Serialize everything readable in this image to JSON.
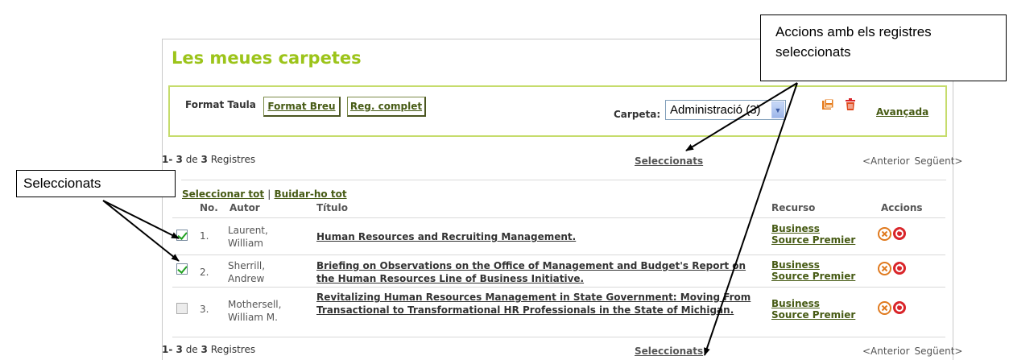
{
  "header": {
    "title": "Les meues carpetes"
  },
  "format": {
    "label": "Format Taula",
    "brief_label": "Format Breu",
    "complete_label": "Reg. complet"
  },
  "folder": {
    "label": "Carpeta:",
    "selected": "Administració (3)",
    "save_icon": "save-icon",
    "delete_icon": "trash-icon",
    "advanced_label": "Avançada"
  },
  "results": {
    "range": "1- 3",
    "of": "de",
    "total": "3",
    "unit": "Registres",
    "selected_link": "Seleccionats",
    "prev": "<Anterior",
    "next": "Següent>"
  },
  "selection": {
    "select_all": "Seleccionar tot",
    "separator": "|",
    "clear_all": "Buidar-ho tot"
  },
  "table": {
    "headers": {
      "no": "No.",
      "autor": "Autor",
      "titulo": "Título",
      "recurso": "Recurso",
      "accions": "Accions"
    },
    "rows": [
      {
        "checked": true,
        "no": "1.",
        "autor_1": "Laurent,",
        "autor_2": "William",
        "titulo": "Human Resources and Recruiting Management.",
        "recurso_1": "Business",
        "recurso_2": "Source Premier"
      },
      {
        "checked": true,
        "no": "2.",
        "autor_1": "Sherrill,",
        "autor_2": "Andrew",
        "titulo": "Briefing on Observations on the Office of Management and Budget's Report on the Human Resources Line of Business Initiative.",
        "recurso_1": "Business",
        "recurso_2": "Source Premier"
      },
      {
        "checked": false,
        "no": "3.",
        "autor_1": "Mothersell,",
        "autor_2": "William M.",
        "titulo": "Revitalizing Human Resources Management in State Government: Moving From Transactional to Transformational HR Professionals in the State of Michigan.",
        "recurso_1": "Business",
        "recurso_2": "Source Premier"
      }
    ]
  },
  "callouts": {
    "actions": "Accions amb els registres seleccionats",
    "selected": "Seleccionats"
  },
  "colors": {
    "accent": "#9cc41a",
    "link": "#475b15",
    "box_border": "#c6dc6c",
    "check": "#21a121",
    "remove": "#e07a1f",
    "redo": "#d9252a"
  }
}
